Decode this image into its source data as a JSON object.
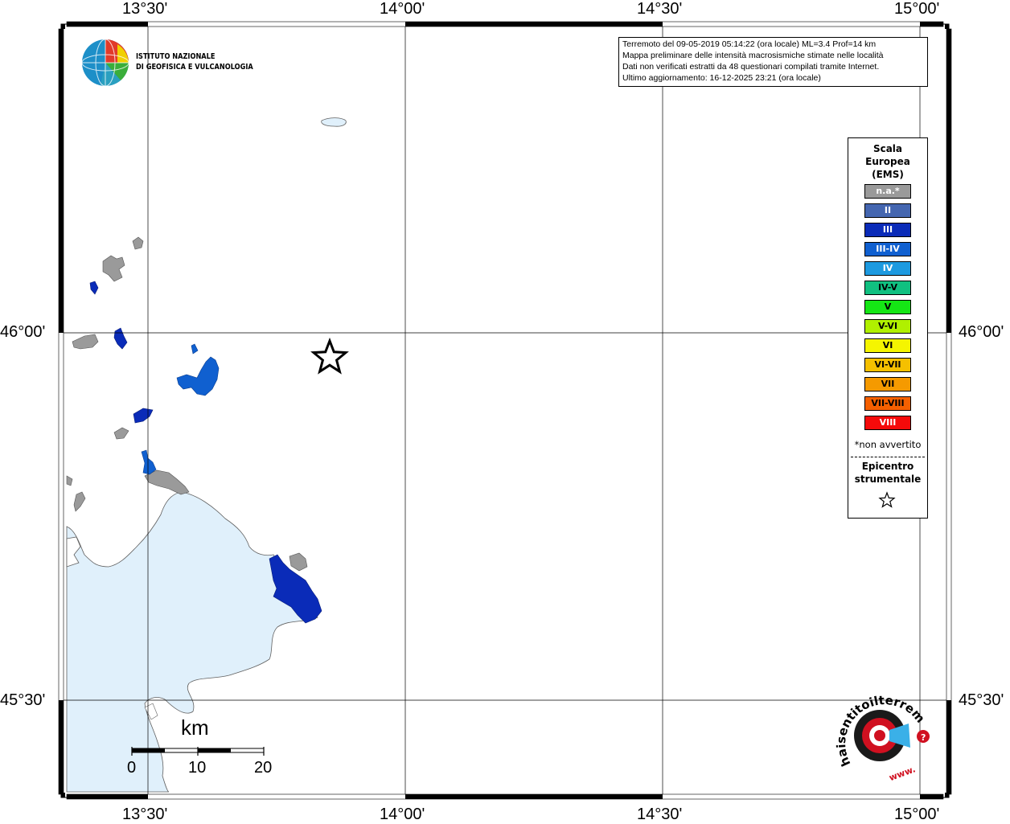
{
  "map": {
    "lon_labels": [
      "13°30'",
      "14°00'",
      "14°30'",
      "15°00'"
    ],
    "lat_labels": [
      "46°00'",
      "45°30'"
    ]
  },
  "institute": {
    "line1": "ISTITUTO NAZIONALE",
    "line2": "DI GEOFISICA E VULCANOLOGIA"
  },
  "info": {
    "line1": "Terremoto del 09-05-2019 05:14:22 (ora locale) ML=3.4 Prof=14 km",
    "line2": "Mappa preliminare delle intensità macrosismiche stimate nelle località",
    "line3": "Dati non verificati estratti da 48 questionari compilati tramite Internet.",
    "line4": "Ultimo aggiornamento: 16-12-2025 23:21 (ora locale)"
  },
  "legend": {
    "title_line1": "Scala",
    "title_line2": "Europea",
    "title_line3": "(EMS)",
    "items": [
      {
        "label": "n.a.*",
        "color": "#9a9a9a",
        "text_color": "#ffffff"
      },
      {
        "label": "II",
        "color": "#4466b0",
        "text_color": "#ffffff"
      },
      {
        "label": "III",
        "color": "#0a2bb8",
        "text_color": "#ffffff"
      },
      {
        "label": "III-IV",
        "color": "#1060d0",
        "text_color": "#ffffff"
      },
      {
        "label": "IV",
        "color": "#1d9ae0",
        "text_color": "#ffffff"
      },
      {
        "label": "IV-V",
        "color": "#10c080",
        "text_color": "#000000"
      },
      {
        "label": "V",
        "color": "#15e615",
        "text_color": "#000000"
      },
      {
        "label": "V-VI",
        "color": "#b0f000",
        "text_color": "#000000"
      },
      {
        "label": "VI",
        "color": "#f5f500",
        "text_color": "#000000"
      },
      {
        "label": "VI-VII",
        "color": "#f5c000",
        "text_color": "#000000"
      },
      {
        "label": "VII",
        "color": "#f59a00",
        "text_color": "#000000"
      },
      {
        "label": "VII-VIII",
        "color": "#f56000",
        "text_color": "#000000"
      },
      {
        "label": "VIII",
        "color": "#f50a0a",
        "text_color": "#ffffff"
      }
    ],
    "note": "*non avvertito",
    "epicenter_line1": "Epicentro",
    "epicenter_line2": "strumentale"
  },
  "scale_bar": {
    "unit": "km",
    "labels": [
      "0",
      "10",
      "20"
    ]
  },
  "site_logo": {
    "text": "haisentitoilterremoto.it",
    "sub": "www."
  },
  "colors": {
    "sea": "#e0f0fb",
    "land": "#ffffff",
    "frame": "#000000",
    "grid": "#000000"
  }
}
